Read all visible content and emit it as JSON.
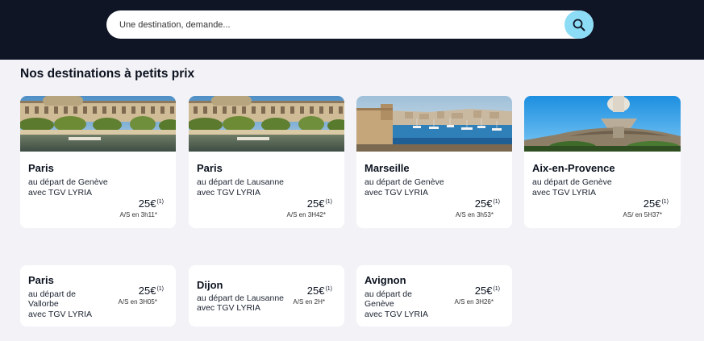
{
  "search": {
    "placeholder": "Une destination, demande..."
  },
  "section": {
    "title": "Nos destinations à petits prix"
  },
  "cards": [
    {
      "city": "Paris",
      "lines": [
        "au départ de Genève",
        "avec TGV LYRIA"
      ],
      "price": "25€",
      "note": "(1)",
      "duration": "A/S en 3h11*",
      "image": "paris-louvre-photo"
    },
    {
      "city": "Paris",
      "lines": [
        "au départ de Lausanne",
        "avec TGV LYRIA"
      ],
      "price": "25€",
      "note": "(1)",
      "duration": "A/S en 3H42*",
      "image": "paris-louvre-photo"
    },
    {
      "city": "Marseille",
      "lines": [
        "au départ de Genève",
        "avec TGV LYRIA"
      ],
      "price": "25€",
      "note": "(1)",
      "duration": "A/S en 3h53*",
      "image": "marseille-harbor-photo"
    },
    {
      "city": "Aix-en-Provence",
      "lines": [
        "au départ de Genève",
        "avec TGV LYRIA"
      ],
      "price": "25€",
      "note": "(1)",
      "duration": "AS/ en 5H37*",
      "image": "aix-fountain-photo"
    },
    {
      "city": "Paris",
      "lines": [
        "au départ de",
        "Vallorbe",
        "avec TGV LYRIA"
      ],
      "price": "25€",
      "note": "(1)",
      "duration": "A/S en 3H05*"
    },
    {
      "city": "Dijon",
      "lines": [
        "au départ de Lausanne",
        "avec TGV LYRIA"
      ],
      "price": "25€",
      "note": "(1)",
      "duration": "A/S en 2H*"
    },
    {
      "city": "Avignon",
      "lines": [
        "au départ de",
        "Genève",
        "avec TGV LYRIA"
      ],
      "price": "25€",
      "note": "(1)",
      "duration": "A/S en 3H26*"
    }
  ],
  "colors": {
    "header": "#0f1525",
    "search_button": "#8ddcf5",
    "page_bg": "#f3f2f7"
  }
}
